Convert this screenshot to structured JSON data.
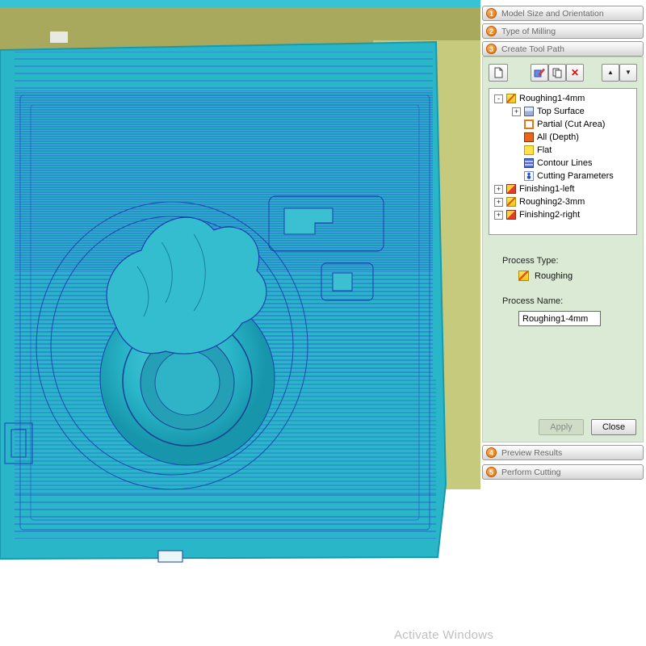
{
  "colors": {
    "accent_orange": "#e8821e",
    "panel_green": "#dbead5",
    "model_teal": "#2ab6c9",
    "toolpath_blue": "#2a50cc",
    "stock_olive": "#a8a95c",
    "stock_light_olive": "#c6ca7c"
  },
  "steps": [
    {
      "num": "1",
      "label": "Model Size and Orientation"
    },
    {
      "num": "2",
      "label": "Type of Milling"
    },
    {
      "num": "3",
      "label": "Create Tool Path"
    },
    {
      "num": "4",
      "label": "Preview Results"
    },
    {
      "num": "5",
      "label": "Perform Cutting"
    }
  ],
  "toolbar": {
    "buttons": [
      "new-toolpath",
      "edit-toolpath",
      "copy-toolpath",
      "delete-toolpath",
      "move-up",
      "move-down"
    ],
    "delete_glyph": "✕",
    "up_glyph": "▲",
    "down_glyph": "▼"
  },
  "tree": {
    "items": [
      {
        "label": "Roughing1-4mm",
        "icon": "roughing",
        "expander": "-"
      },
      {
        "label": "Top Surface",
        "icon": "surface",
        "expander": "+"
      },
      {
        "label": "Partial (Cut Area)",
        "icon": "partial"
      },
      {
        "label": "All (Depth)",
        "icon": "depth"
      },
      {
        "label": "Flat",
        "icon": "flat"
      },
      {
        "label": "Contour Lines",
        "icon": "contour"
      },
      {
        "label": "Cutting Parameters",
        "icon": "params"
      },
      {
        "label": "Finishing1-left",
        "icon": "finishing",
        "expander": "+"
      },
      {
        "label": "Roughing2-3mm",
        "icon": "roughing",
        "expander": "+"
      },
      {
        "label": "Finishing2-right",
        "icon": "finishing",
        "expander": "+"
      }
    ]
  },
  "process": {
    "type_label": "Process Type:",
    "type_value": "Roughing",
    "name_label": "Process Name:",
    "name_value": "Roughing1-4mm"
  },
  "actions": {
    "apply": "Apply",
    "close": "Close"
  },
  "watermark": "Activate Windows"
}
